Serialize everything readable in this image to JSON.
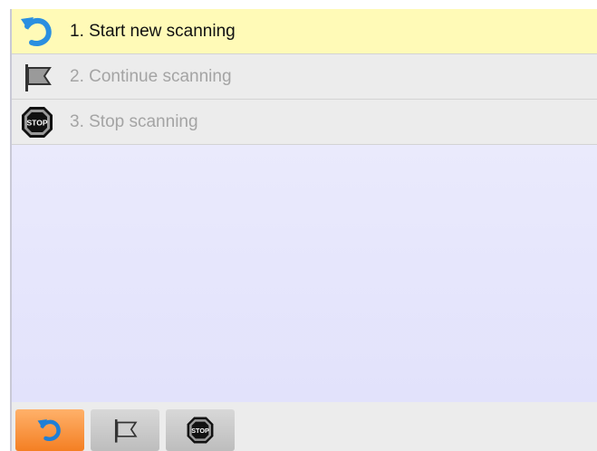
{
  "menu": {
    "items": [
      {
        "label": "1. Start new scanning",
        "icon": "undo-arrow-icon",
        "state": "active"
      },
      {
        "label": "2. Continue scanning",
        "icon": "flag-icon",
        "state": "disabled"
      },
      {
        "label": "3. Stop scanning",
        "icon": "stop-sign-icon",
        "state": "disabled"
      }
    ]
  },
  "toolbar": {
    "buttons": [
      {
        "icon": "undo-arrow-icon",
        "color": "#f47f23"
      },
      {
        "icon": "flag-icon",
        "color": "#cccccc"
      },
      {
        "icon": "stop-sign-icon",
        "color": "#cccccc"
      }
    ]
  },
  "stop_sign_text": "STOP"
}
